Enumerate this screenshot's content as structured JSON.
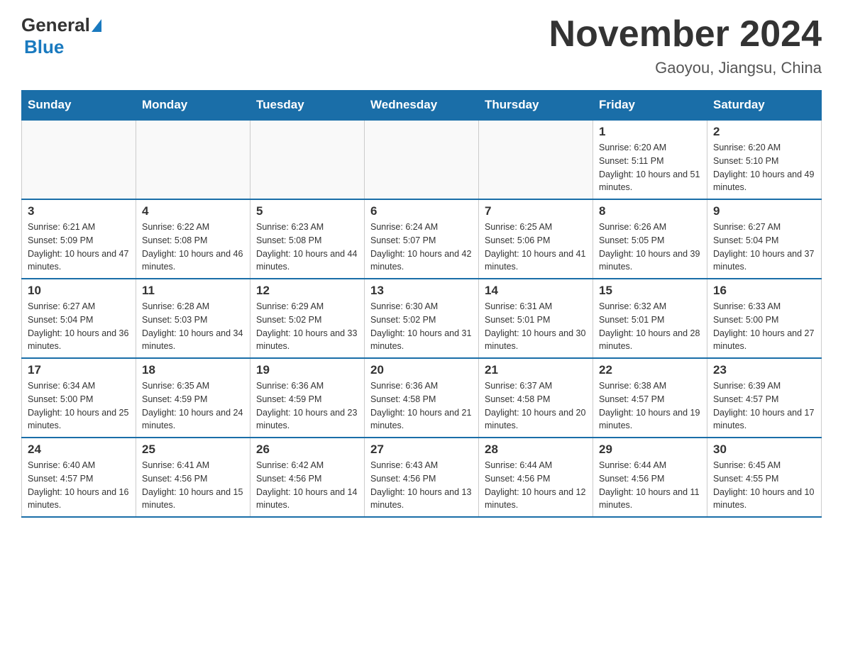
{
  "header": {
    "logo_general": "General",
    "logo_blue": "Blue",
    "title": "November 2024",
    "subtitle": "Gaoyou, Jiangsu, China"
  },
  "days_of_week": [
    "Sunday",
    "Monday",
    "Tuesday",
    "Wednesday",
    "Thursday",
    "Friday",
    "Saturday"
  ],
  "weeks": [
    [
      {
        "day": "",
        "info": ""
      },
      {
        "day": "",
        "info": ""
      },
      {
        "day": "",
        "info": ""
      },
      {
        "day": "",
        "info": ""
      },
      {
        "day": "",
        "info": ""
      },
      {
        "day": "1",
        "info": "Sunrise: 6:20 AM\nSunset: 5:11 PM\nDaylight: 10 hours and 51 minutes."
      },
      {
        "day": "2",
        "info": "Sunrise: 6:20 AM\nSunset: 5:10 PM\nDaylight: 10 hours and 49 minutes."
      }
    ],
    [
      {
        "day": "3",
        "info": "Sunrise: 6:21 AM\nSunset: 5:09 PM\nDaylight: 10 hours and 47 minutes."
      },
      {
        "day": "4",
        "info": "Sunrise: 6:22 AM\nSunset: 5:08 PM\nDaylight: 10 hours and 46 minutes."
      },
      {
        "day": "5",
        "info": "Sunrise: 6:23 AM\nSunset: 5:08 PM\nDaylight: 10 hours and 44 minutes."
      },
      {
        "day": "6",
        "info": "Sunrise: 6:24 AM\nSunset: 5:07 PM\nDaylight: 10 hours and 42 minutes."
      },
      {
        "day": "7",
        "info": "Sunrise: 6:25 AM\nSunset: 5:06 PM\nDaylight: 10 hours and 41 minutes."
      },
      {
        "day": "8",
        "info": "Sunrise: 6:26 AM\nSunset: 5:05 PM\nDaylight: 10 hours and 39 minutes."
      },
      {
        "day": "9",
        "info": "Sunrise: 6:27 AM\nSunset: 5:04 PM\nDaylight: 10 hours and 37 minutes."
      }
    ],
    [
      {
        "day": "10",
        "info": "Sunrise: 6:27 AM\nSunset: 5:04 PM\nDaylight: 10 hours and 36 minutes."
      },
      {
        "day": "11",
        "info": "Sunrise: 6:28 AM\nSunset: 5:03 PM\nDaylight: 10 hours and 34 minutes."
      },
      {
        "day": "12",
        "info": "Sunrise: 6:29 AM\nSunset: 5:02 PM\nDaylight: 10 hours and 33 minutes."
      },
      {
        "day": "13",
        "info": "Sunrise: 6:30 AM\nSunset: 5:02 PM\nDaylight: 10 hours and 31 minutes."
      },
      {
        "day": "14",
        "info": "Sunrise: 6:31 AM\nSunset: 5:01 PM\nDaylight: 10 hours and 30 minutes."
      },
      {
        "day": "15",
        "info": "Sunrise: 6:32 AM\nSunset: 5:01 PM\nDaylight: 10 hours and 28 minutes."
      },
      {
        "day": "16",
        "info": "Sunrise: 6:33 AM\nSunset: 5:00 PM\nDaylight: 10 hours and 27 minutes."
      }
    ],
    [
      {
        "day": "17",
        "info": "Sunrise: 6:34 AM\nSunset: 5:00 PM\nDaylight: 10 hours and 25 minutes."
      },
      {
        "day": "18",
        "info": "Sunrise: 6:35 AM\nSunset: 4:59 PM\nDaylight: 10 hours and 24 minutes."
      },
      {
        "day": "19",
        "info": "Sunrise: 6:36 AM\nSunset: 4:59 PM\nDaylight: 10 hours and 23 minutes."
      },
      {
        "day": "20",
        "info": "Sunrise: 6:36 AM\nSunset: 4:58 PM\nDaylight: 10 hours and 21 minutes."
      },
      {
        "day": "21",
        "info": "Sunrise: 6:37 AM\nSunset: 4:58 PM\nDaylight: 10 hours and 20 minutes."
      },
      {
        "day": "22",
        "info": "Sunrise: 6:38 AM\nSunset: 4:57 PM\nDaylight: 10 hours and 19 minutes."
      },
      {
        "day": "23",
        "info": "Sunrise: 6:39 AM\nSunset: 4:57 PM\nDaylight: 10 hours and 17 minutes."
      }
    ],
    [
      {
        "day": "24",
        "info": "Sunrise: 6:40 AM\nSunset: 4:57 PM\nDaylight: 10 hours and 16 minutes."
      },
      {
        "day": "25",
        "info": "Sunrise: 6:41 AM\nSunset: 4:56 PM\nDaylight: 10 hours and 15 minutes."
      },
      {
        "day": "26",
        "info": "Sunrise: 6:42 AM\nSunset: 4:56 PM\nDaylight: 10 hours and 14 minutes."
      },
      {
        "day": "27",
        "info": "Sunrise: 6:43 AM\nSunset: 4:56 PM\nDaylight: 10 hours and 13 minutes."
      },
      {
        "day": "28",
        "info": "Sunrise: 6:44 AM\nSunset: 4:56 PM\nDaylight: 10 hours and 12 minutes."
      },
      {
        "day": "29",
        "info": "Sunrise: 6:44 AM\nSunset: 4:56 PM\nDaylight: 10 hours and 11 minutes."
      },
      {
        "day": "30",
        "info": "Sunrise: 6:45 AM\nSunset: 4:55 PM\nDaylight: 10 hours and 10 minutes."
      }
    ]
  ]
}
